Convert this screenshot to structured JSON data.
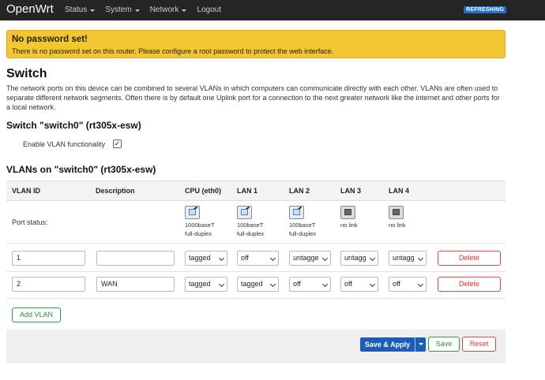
{
  "app": {
    "brand": "OpenWrt",
    "badge": "REFRESHING"
  },
  "menu": [
    {
      "label": "Status"
    },
    {
      "label": "System"
    },
    {
      "label": "Network"
    },
    {
      "label": "Logout"
    }
  ],
  "alert": {
    "title": "No password set!",
    "text": "There is no password set on this router. Please configure a root password to protect the web interface."
  },
  "page": {
    "title": "Switch",
    "description": "The network ports on this device can be combined to several VLANs in which computers can communicate directly with each other. VLANs are often used to separate different network segments. Often there is by default one Uplink port for a connection to the next greater network like the internet and other ports for a local network.",
    "switch_heading": "Switch \"switch0\" (rt305x-esw)",
    "vlan_toggle_label": "Enable VLAN functionality",
    "vlan_toggle_checked": true,
    "vlans_heading": "VLANs on \"switch0\" (rt305x-esw)"
  },
  "table": {
    "headers": [
      "VLAN ID",
      "Description",
      "CPU (eth0)",
      "LAN 1",
      "LAN 2",
      "LAN 3",
      "LAN 4"
    ],
    "port_status_label": "Port status:",
    "port_status": [
      {
        "line1": "1000baseT",
        "line2": "full-duplex",
        "link": "up"
      },
      {
        "line1": "100baseT",
        "line2": "full-duplex",
        "link": "up"
      },
      {
        "line1": "100baseT",
        "line2": "full-duplex",
        "link": "up"
      },
      {
        "line1": "no link",
        "line2": "",
        "link": "down"
      },
      {
        "line1": "no link",
        "line2": "",
        "link": "down"
      }
    ],
    "rows": [
      {
        "vlan_id": "1",
        "description": "",
        "ports": [
          "tagged",
          "off",
          "untagge",
          "untagg",
          "untagg"
        ],
        "delete": "Delete"
      },
      {
        "vlan_id": "2",
        "description": "WAN",
        "ports": [
          "tagged",
          "tagged",
          "off",
          "off",
          "off"
        ],
        "delete": "Delete"
      }
    ]
  },
  "actions": {
    "add_vlan": "Add VLAN",
    "save_apply": "Save & Apply",
    "save": "Save",
    "reset": "Reset"
  }
}
